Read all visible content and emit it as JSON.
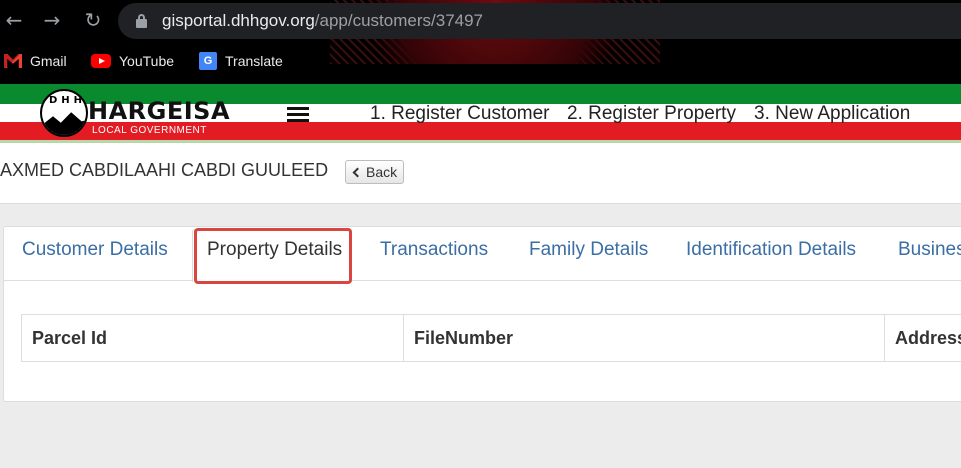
{
  "browser": {
    "url_host": "gisportal.dhhgov.org",
    "url_path": "/app/customers/37497",
    "bookmarks": [
      {
        "label": "Gmail",
        "icon": "gmail-icon"
      },
      {
        "label": "YouTube",
        "icon": "youtube-icon"
      },
      {
        "label": "Translate",
        "icon": "translate-icon"
      }
    ]
  },
  "header": {
    "logo_badge": "DHH",
    "logo_title": "HARGEISA",
    "logo_subtitle": "LOCAL GOVERNMENT",
    "nav": [
      "1. Register Customer",
      "2. Register Property",
      "3. New Application"
    ],
    "colors": {
      "green": "#0a8a2e",
      "red": "#e31b23"
    }
  },
  "page": {
    "customer_name": "AXMED CABDILAAHI CABDI GUULEED",
    "back_label": "Back"
  },
  "tabs": [
    {
      "label": "Customer Details",
      "active": false
    },
    {
      "label": "Property Details",
      "active": true
    },
    {
      "label": "Transactions",
      "active": false
    },
    {
      "label": "Family Details",
      "active": false
    },
    {
      "label": "Identification Details",
      "active": false
    },
    {
      "label": "Busines",
      "active": false
    }
  ],
  "table": {
    "columns": [
      "Parcel Id",
      "FileNumber",
      "Address"
    ]
  },
  "highlight_color": "#d9463f"
}
